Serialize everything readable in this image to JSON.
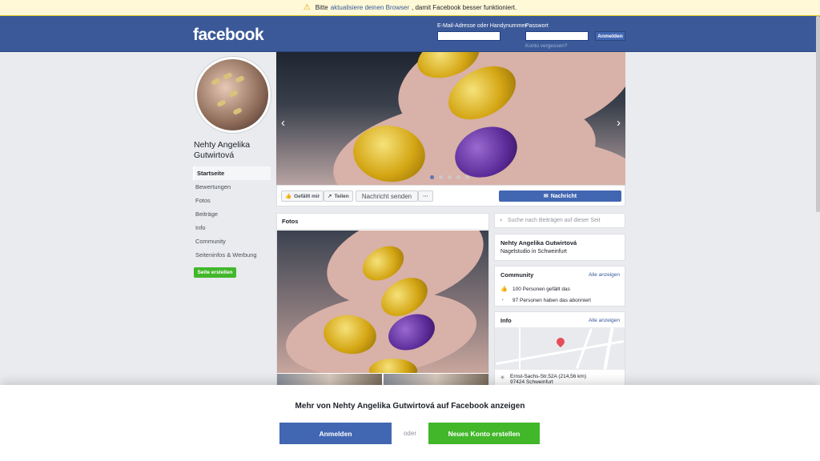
{
  "banner": {
    "icon": "warning-icon",
    "text_before": "Bitte",
    "link": "aktualisiere deinen Browser",
    "text_after": ", damit Facebook besser funktioniert."
  },
  "header": {
    "logo": "facebook",
    "email_label": "E-Mail-Adresse oder Handynummer",
    "password_label": "Passwort",
    "login_button": "Anmelden",
    "forgot_link": "Konto vergessen?"
  },
  "page": {
    "name": "Nehty Angelika Gutwirtová",
    "nav": [
      "Startseite",
      "Bewertungen",
      "Fotos",
      "Beiträge",
      "Info",
      "Community",
      "Seiteninfos & Werbung"
    ],
    "create_page_button": "Seite erstellen"
  },
  "actions": {
    "like": "Gefällt mir",
    "share": "Teilen",
    "message_send": "Nachricht senden",
    "more": "···",
    "message": "Nachricht"
  },
  "photos": {
    "title": "Fotos"
  },
  "sidebar": {
    "search_placeholder": "Suche nach Beiträgen auf dieser Seit",
    "about_name": "Nehty Angelika Gutwirtová",
    "about_category": "Nagelstudio in Schweinfurt",
    "community_title": "Community",
    "see_all": "Alle anzeigen",
    "likes": "100 Personen gefällt das",
    "followers": "97 Personen haben das abonniert",
    "info_title": "Info",
    "address_line1": "Ernst-Sachs-Str.52A (214,56 km)",
    "address_line2": "97424 Schweinfurt"
  },
  "overlay": {
    "title": "Mehr von Nehty Angelika Gutwirtová auf Facebook anzeigen",
    "login": "Anmelden",
    "or": "oder",
    "signup": "Neues Konto erstellen"
  },
  "colors": {
    "brand": "#3b5998",
    "button_blue": "#4267b2",
    "green": "#42b72a"
  }
}
